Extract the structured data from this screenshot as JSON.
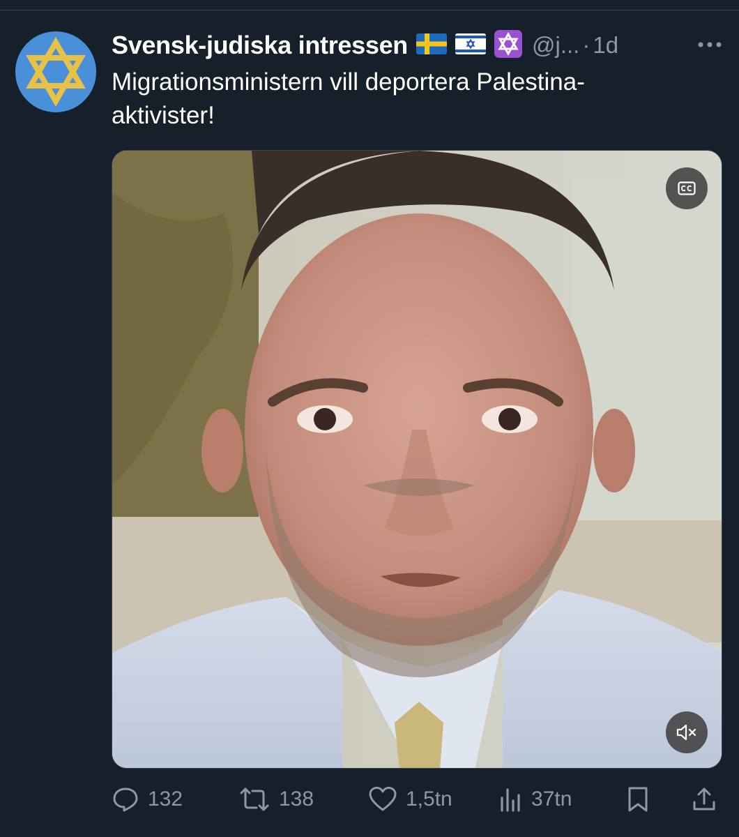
{
  "tweet": {
    "display_name": "Svensk-judiska intressen",
    "handle": "@j...",
    "separator": "·",
    "time": "1d",
    "text_line1": "Migrationsministern vill deportera Palestina-",
    "text_line2": "aktivister!"
  },
  "icons": {
    "avatar": "star-of-david-avatar",
    "flags": [
      "sweden-flag",
      "israel-flag",
      "star-of-david-emoji"
    ],
    "more": "more-icon",
    "cc": "closed-captions-icon",
    "mute": "volume-muted-icon"
  },
  "actions": {
    "reply_count": "132",
    "repost_count": "138",
    "like_count": "1,5tn",
    "views_count": "37tn"
  },
  "colors": {
    "background": "#15202b",
    "text": "#ffffff",
    "muted": "#8b98a5",
    "avatar_bg": "#4a90d9",
    "star": "#e8c247"
  }
}
